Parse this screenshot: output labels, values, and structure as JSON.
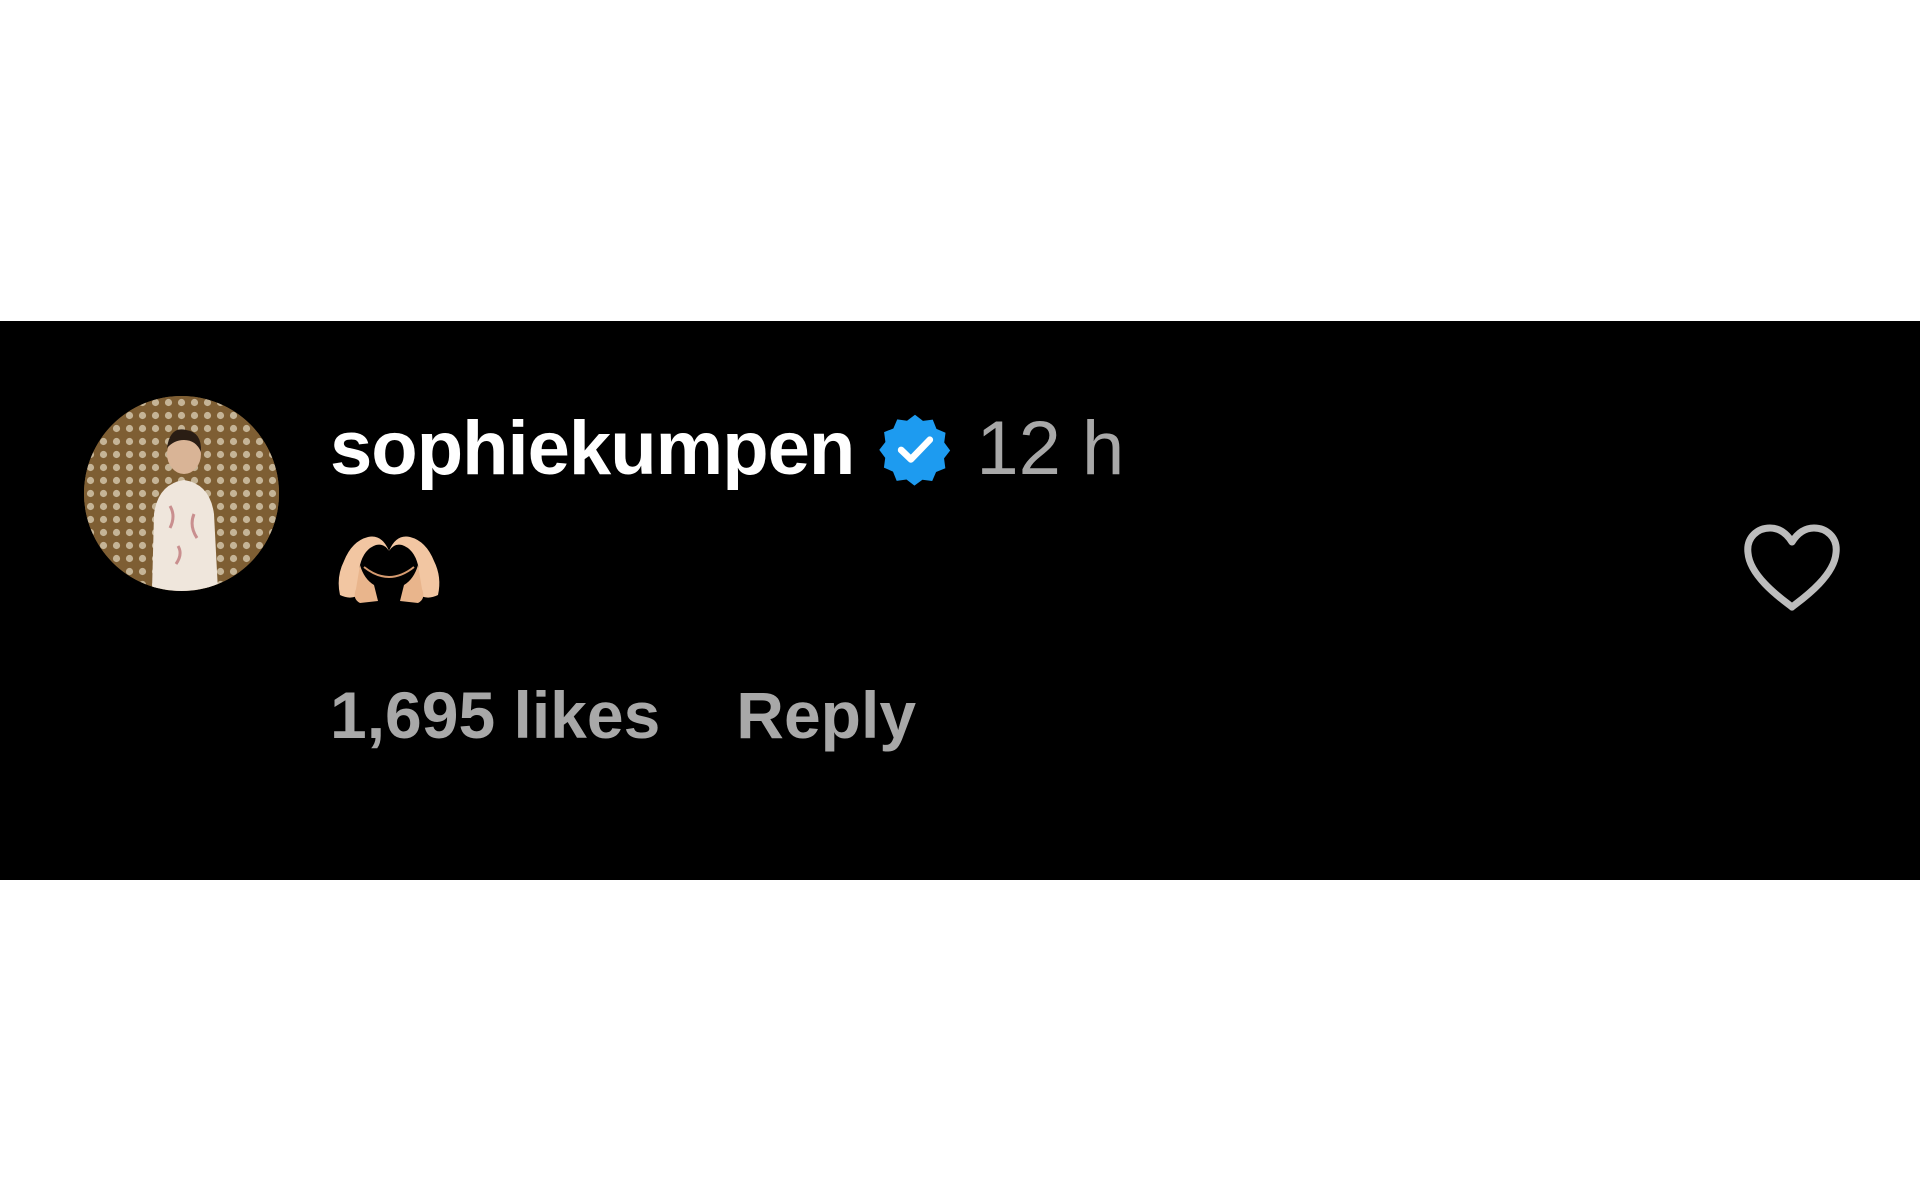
{
  "comment": {
    "username": "sophiekumpen",
    "verified_icon": "verified-badge-icon",
    "timestamp": "12 h",
    "body_emoji": "🫶",
    "body_icon": "heart-hands-icon",
    "likes_label": "1,695 likes",
    "reply_label": "Reply",
    "like_icon": "heart-outline-icon"
  },
  "colors": {
    "background": "#000000",
    "username": "#ffffff",
    "secondary_text": "#a8a8a8",
    "verified_badge": "#1d9bf0"
  }
}
